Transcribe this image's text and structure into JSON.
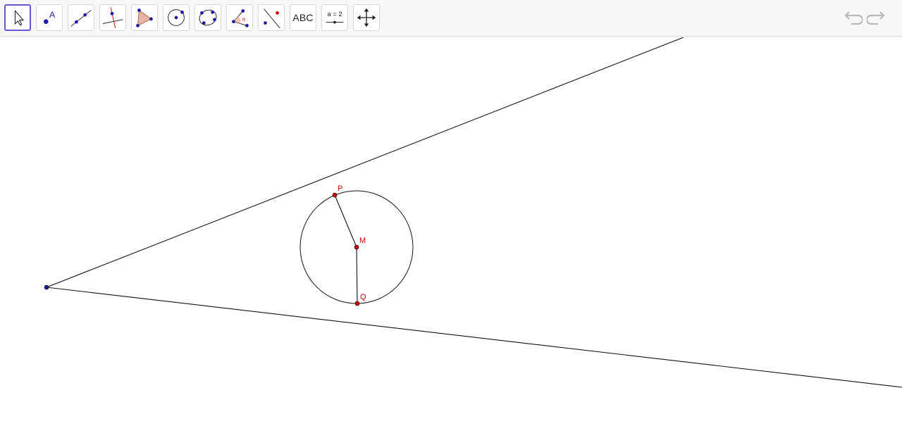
{
  "toolbar": {
    "tools": [
      {
        "name": "move",
        "icon": "move-arrow-icon",
        "active": true
      },
      {
        "name": "point",
        "icon": "point-icon",
        "glyph": "A"
      },
      {
        "name": "line",
        "icon": "line-through-two-points-icon"
      },
      {
        "name": "perpendicular-line",
        "icon": "perpendicular-line-icon"
      },
      {
        "name": "polygon",
        "icon": "polygon-icon"
      },
      {
        "name": "circle-center-point",
        "icon": "circle-center-point-icon"
      },
      {
        "name": "conic-five-points",
        "icon": "conic-five-points-icon"
      },
      {
        "name": "angle",
        "icon": "angle-icon",
        "glyph": "α"
      },
      {
        "name": "reflect",
        "icon": "reflect-about-line-icon"
      },
      {
        "name": "text",
        "icon": "text-tool-icon",
        "label": "ABC"
      },
      {
        "name": "slider",
        "icon": "slider-icon",
        "label": "a = 2"
      },
      {
        "name": "move-graphics-view",
        "icon": "move-view-icon"
      }
    ],
    "undo_icon": "undo-icon",
    "redo_icon": "redo-icon",
    "accent_color": "#6557d2"
  },
  "canvas": {
    "points": [
      {
        "name": "P",
        "label": "P",
        "color": "#d40000"
      },
      {
        "name": "M",
        "label": "M",
        "color": "#d40000"
      },
      {
        "name": "Q",
        "label": "Q",
        "color": "#d40000"
      },
      {
        "name": "vertex",
        "label": "",
        "color": "#1a1aa6"
      }
    ],
    "objects": [
      "ray-upper",
      "ray-lower",
      "circle-c",
      "segment-pm",
      "segment-mq"
    ]
  }
}
